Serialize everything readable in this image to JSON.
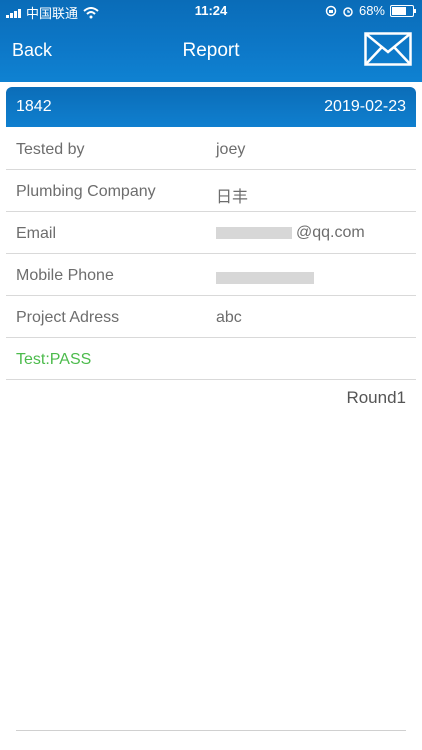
{
  "status": {
    "carrier": "中国联通",
    "time": "11:24",
    "battery": "68%"
  },
  "nav": {
    "back_label": "Back",
    "title": "Report"
  },
  "header": {
    "number": "1842",
    "date": "2019-02-23"
  },
  "rows": [
    {
      "label": "Tested by",
      "value": "joey"
    },
    {
      "label": "Plumbing Company",
      "value": "日丰"
    },
    {
      "label": "Email",
      "value": "@qq.com"
    },
    {
      "label": "Mobile Phone",
      "value": ""
    },
    {
      "label": "Project Adress",
      "value": "abc"
    }
  ],
  "result": "Test:PASS",
  "round_label": "Round1",
  "colors": {
    "accent": "#0d78c8",
    "pass": "#4cbb4c"
  },
  "icons": [
    "signal-icon",
    "wifi-icon",
    "orientation-lock-icon",
    "alarm-icon",
    "battery-icon",
    "mail-icon"
  ]
}
